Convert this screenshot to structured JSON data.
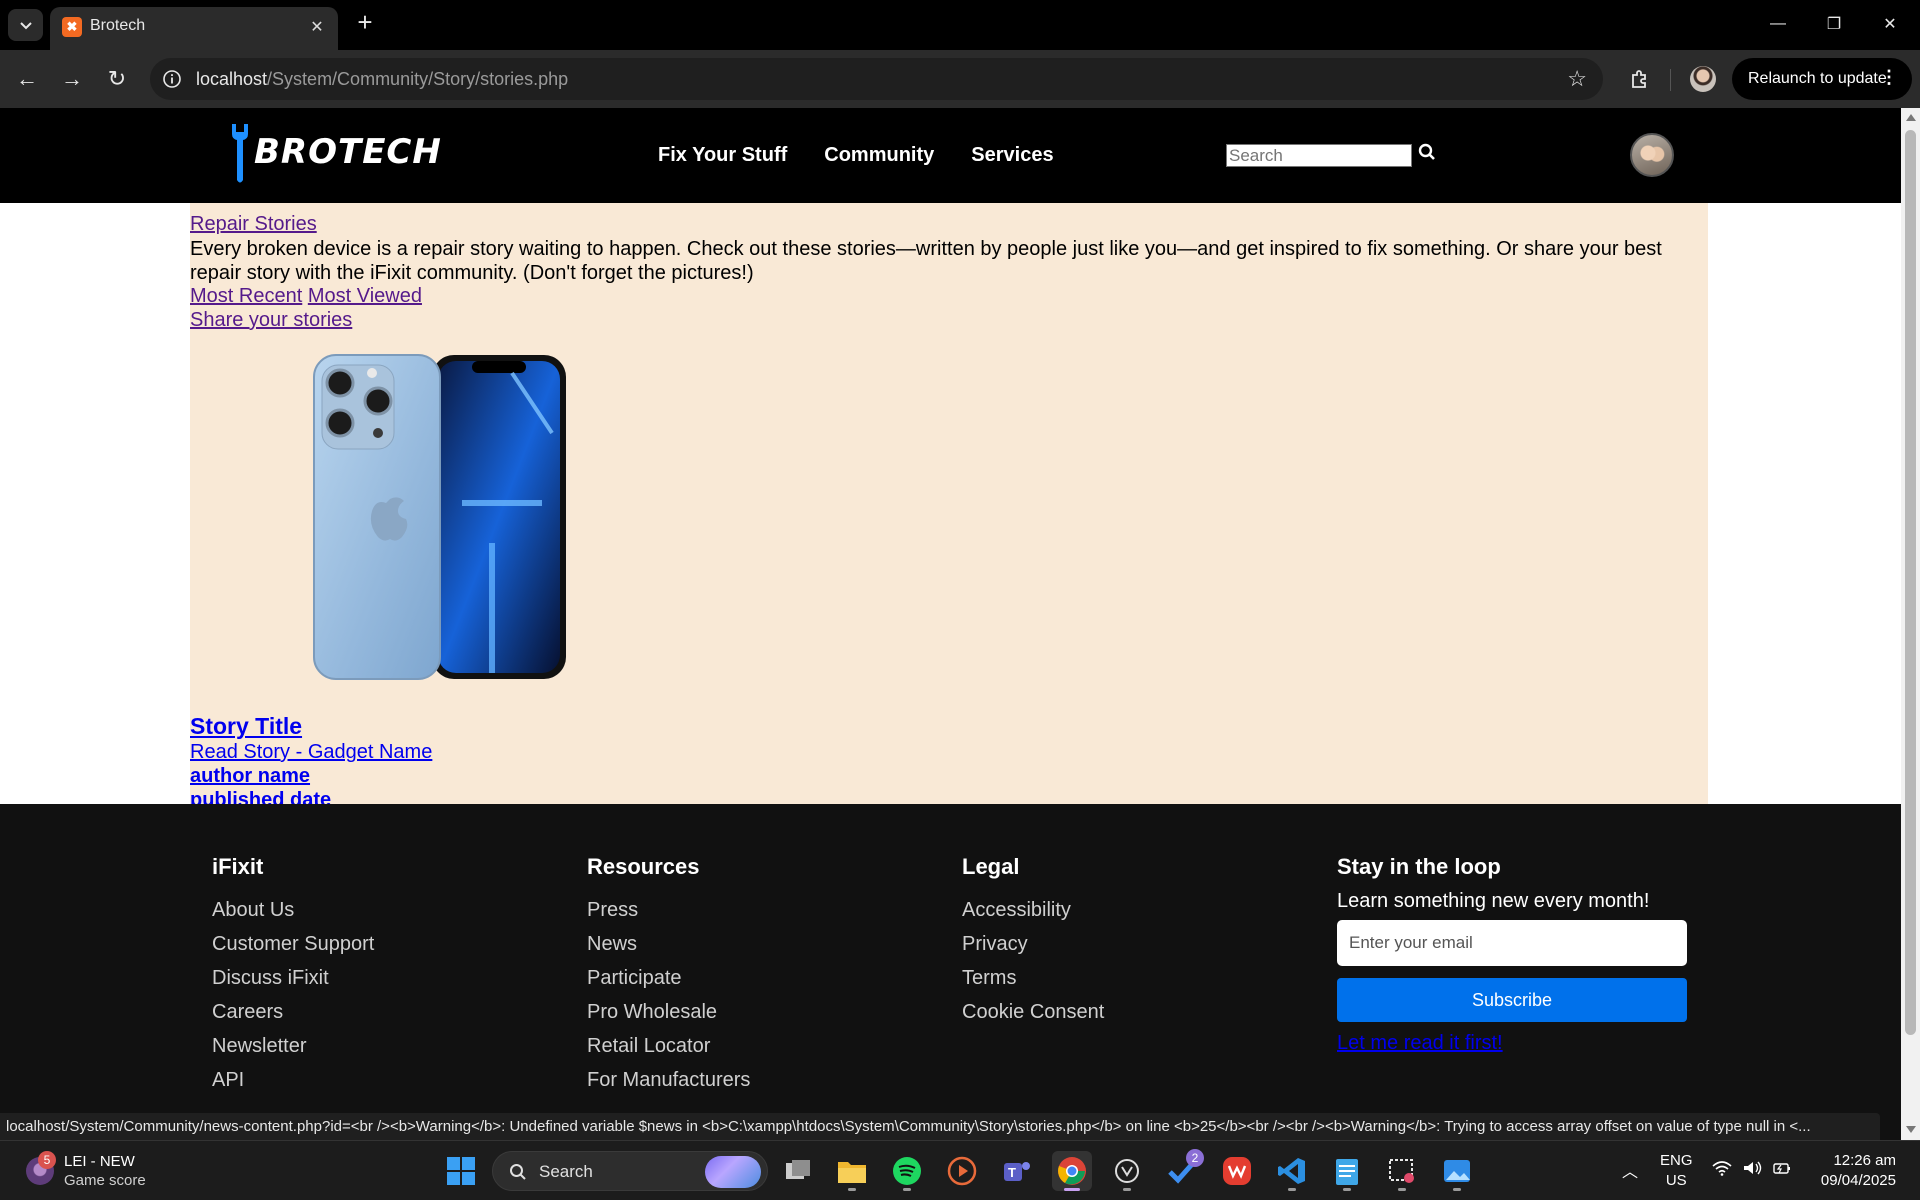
{
  "browser": {
    "tab_title": "Brotech",
    "url_host": "localhost",
    "url_path": "/System/Community/Story/stories.php",
    "relaunch_label": "Relaunch to update"
  },
  "site": {
    "brand": "BROTECH",
    "nav": [
      "Fix Your Stuff",
      "Community",
      "Services"
    ],
    "search_placeholder": "Search"
  },
  "content": {
    "heading_link": "Repair Stories",
    "intro": "Every broken device is a repair story waiting to happen. Check out these stories—written by people just like you—and get inspired to fix something. Or share your best repair story with the iFixit community. (Don't forget the pictures!)",
    "sort_recent": "Most Recent",
    "sort_viewed": "Most Viewed",
    "share_link": "Share your stories",
    "story": {
      "title": "Story Title",
      "read_link": "Read Story - Gadget Name",
      "author": "author name",
      "date": "published date"
    }
  },
  "footer": {
    "col1": {
      "title": "iFixit",
      "links": [
        "About Us",
        "Customer Support",
        "Discuss iFixit",
        "Careers",
        "Newsletter",
        "API"
      ]
    },
    "col2": {
      "title": "Resources",
      "links": [
        "Press",
        "News",
        "Participate",
        "Pro Wholesale",
        "Retail Locator",
        "For Manufacturers"
      ]
    },
    "col3": {
      "title": "Legal",
      "links": [
        "Accessibility",
        "Privacy",
        "Terms",
        "Cookie Consent"
      ]
    },
    "newsletter": {
      "title": "Stay in the loop",
      "subtitle": "Learn something new every month!",
      "email_placeholder": "Enter your email",
      "subscribe_label": "Subscribe",
      "read_first": "Let me read it first!"
    }
  },
  "status_url": "localhost/System/Community/news-content.php?id=<br /><b>Warning</b>:  Undefined variable $news in <b>C:\\xampp\\htdocs\\System\\Community\\Story\\stories.php</b> on line <b>25</b><br /><br /><b>Warning</b>:  Trying to access array offset on value of type null in <...",
  "taskbar": {
    "widget_title": "LEI - NEW",
    "widget_subtitle": "Game score",
    "widget_badge": "5",
    "search_label": "Search",
    "app_badge": "2",
    "lang_line1": "ENG",
    "lang_line2": "US",
    "time": "12:26 am",
    "date": "09/04/2025"
  },
  "colors": {
    "content_bg": "#f9e9d6",
    "footer_bg": "#111111",
    "subscribe_blue": "#0071eb",
    "visited_link": "#551a8b",
    "link_blue": "#0000ee"
  }
}
